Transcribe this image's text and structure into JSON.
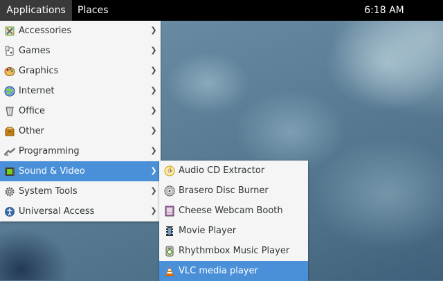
{
  "topbar": {
    "applications_label": "Applications",
    "places_label": "Places",
    "clock": "6:18 AM"
  },
  "menu": {
    "items": [
      {
        "label": "Accessories",
        "icon": "accessories-icon"
      },
      {
        "label": "Games",
        "icon": "games-icon"
      },
      {
        "label": "Graphics",
        "icon": "graphics-icon"
      },
      {
        "label": "Internet",
        "icon": "internet-icon"
      },
      {
        "label": "Office",
        "icon": "office-icon"
      },
      {
        "label": "Other",
        "icon": "other-icon"
      },
      {
        "label": "Programming",
        "icon": "programming-icon"
      },
      {
        "label": "Sound & Video",
        "icon": "sound-video-icon",
        "active": true
      },
      {
        "label": "System Tools",
        "icon": "system-tools-icon"
      },
      {
        "label": "Universal Access",
        "icon": "universal-access-icon"
      }
    ]
  },
  "submenu": {
    "items": [
      {
        "label": "Audio CD Extractor",
        "icon": "audio-cd-icon"
      },
      {
        "label": "Brasero Disc Burner",
        "icon": "brasero-icon"
      },
      {
        "label": "Cheese Webcam Booth",
        "icon": "cheese-icon"
      },
      {
        "label": "Movie Player",
        "icon": "movie-player-icon"
      },
      {
        "label": "Rhythmbox Music Player",
        "icon": "rhythmbox-icon"
      },
      {
        "label": "VLC media player",
        "icon": "vlc-icon",
        "active": true
      }
    ]
  },
  "colors": {
    "highlight": "#4a90d9",
    "menu_bg": "#f5f5f5",
    "topbar_bg": "#000000"
  }
}
